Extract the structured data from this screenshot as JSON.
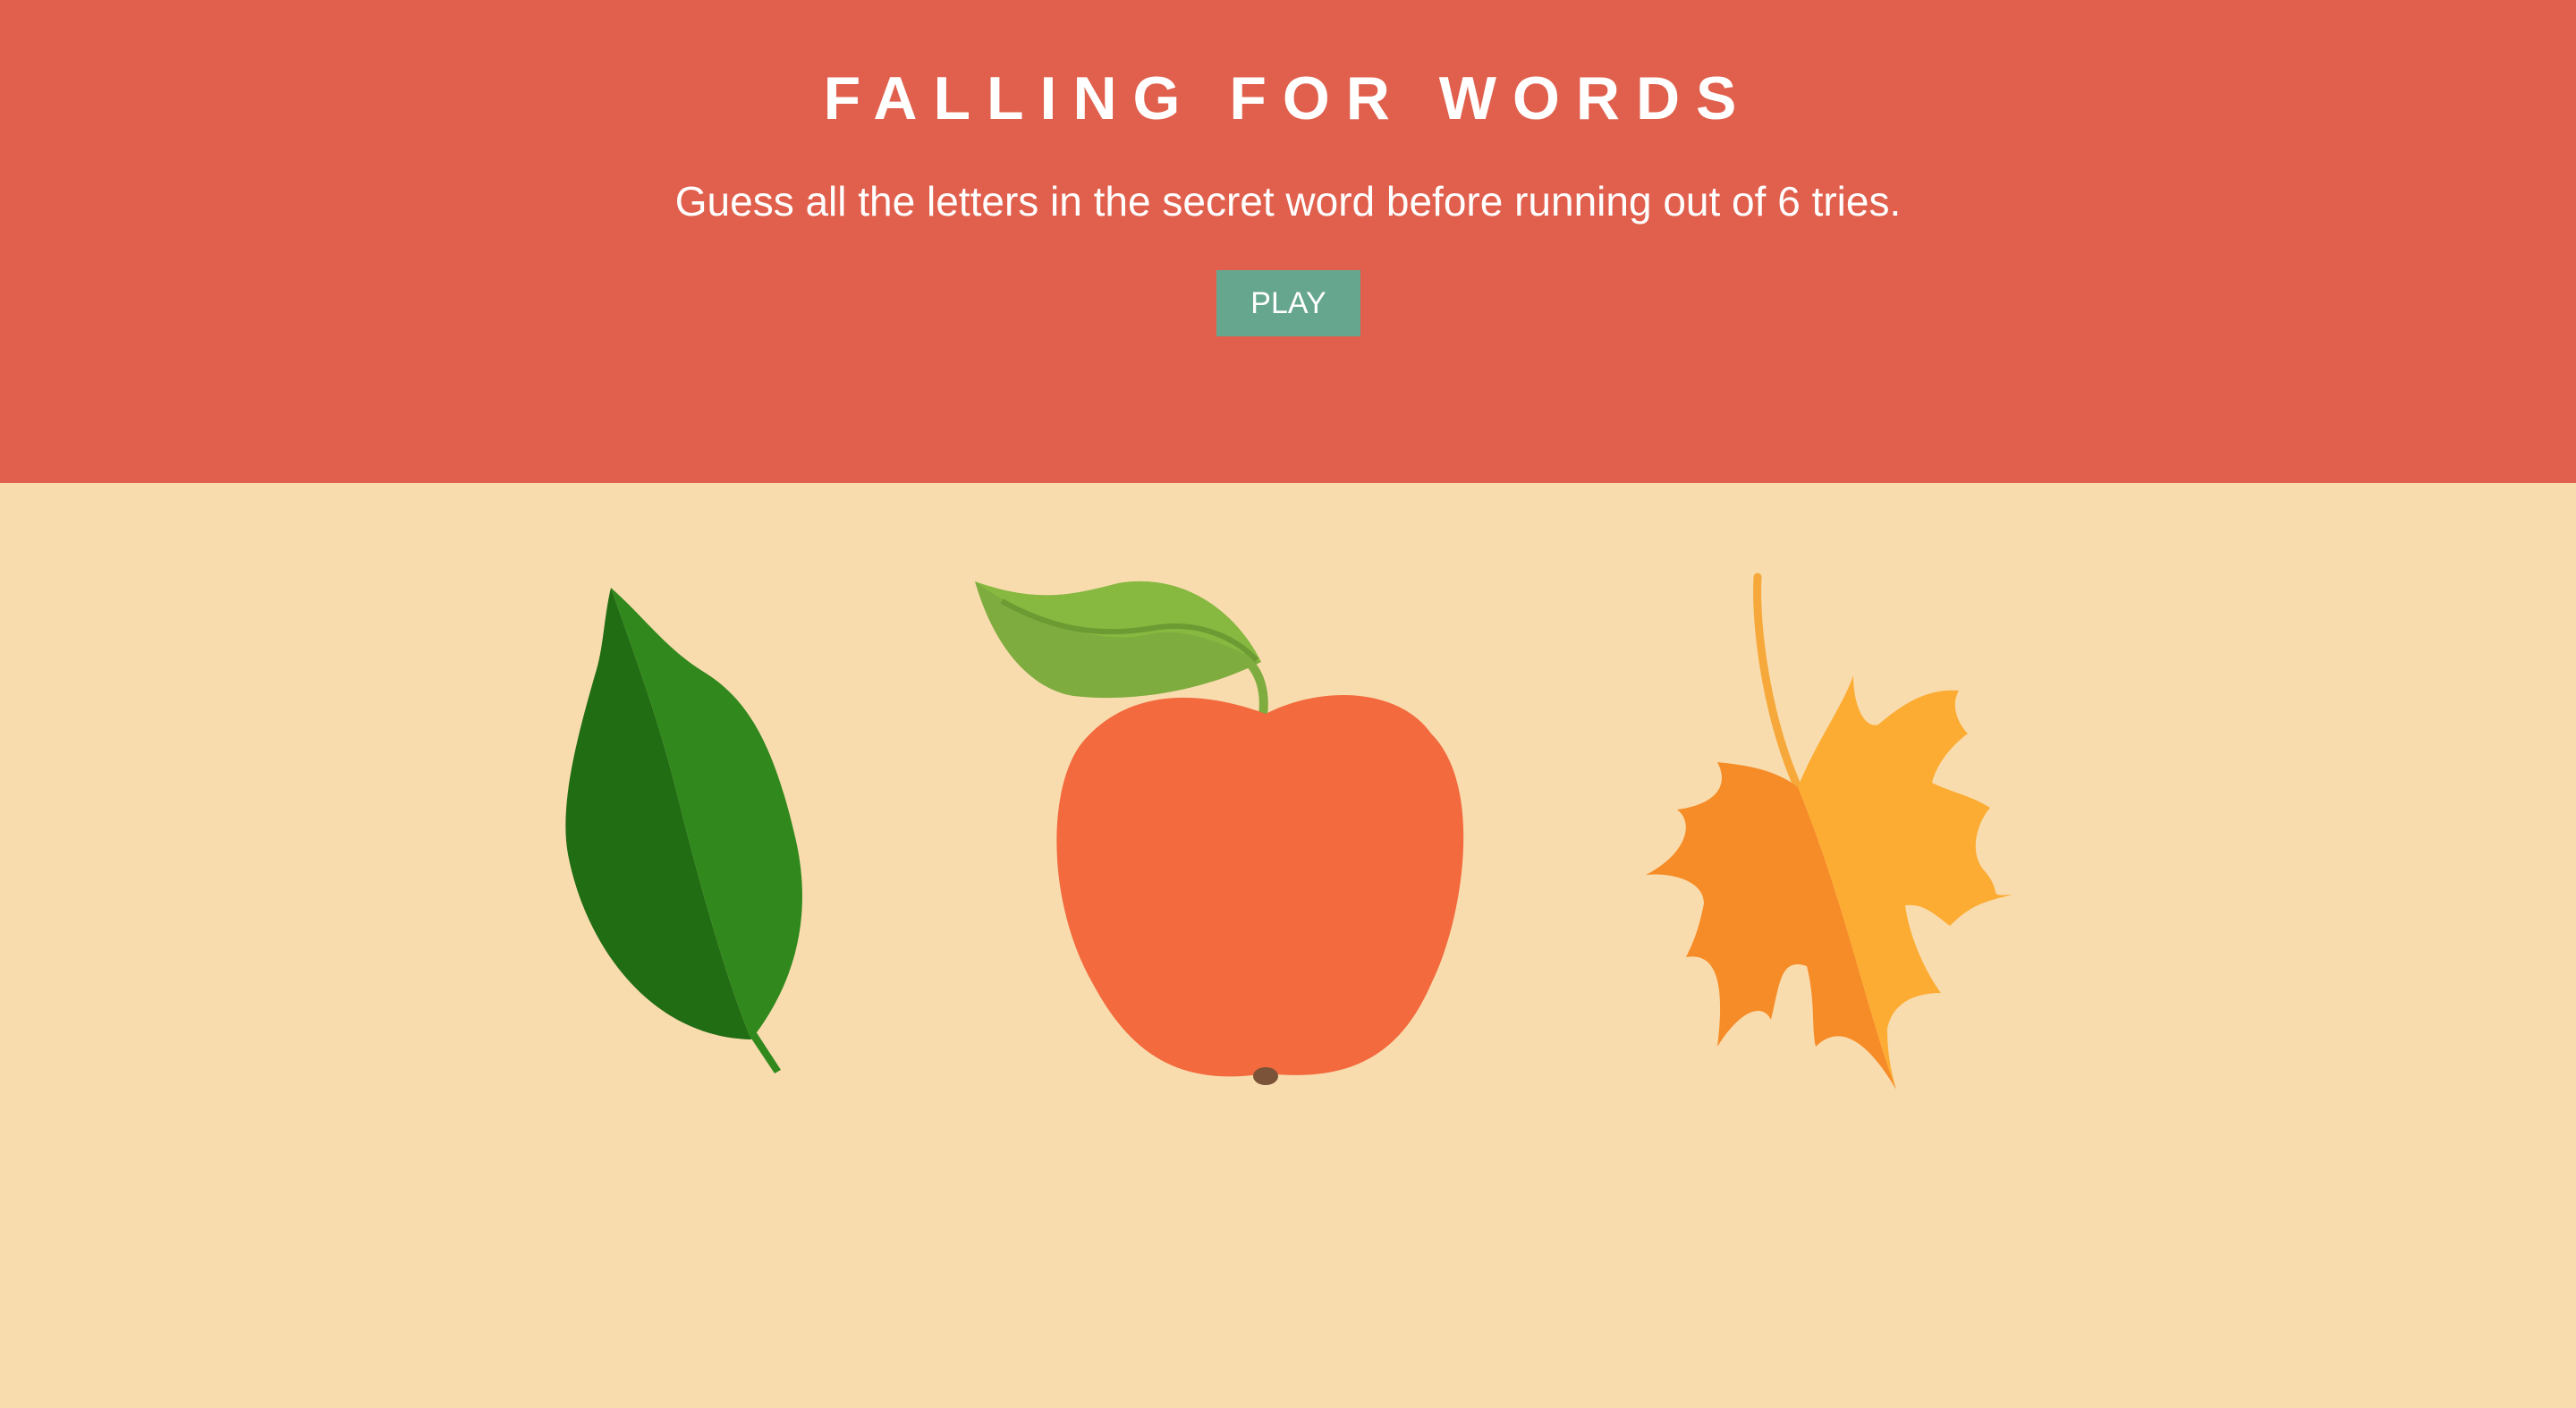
{
  "header": {
    "title": "FALLING FOR WORDS",
    "subtitle": "Guess all the letters in the secret word before running out of 6 tries.",
    "play_label": "PLAY"
  },
  "colors": {
    "header_bg": "#e0604d",
    "page_bg": "#f9dcae",
    "button_bg": "#66a68f",
    "text": "#ffffff"
  },
  "icons": [
    "green-leaf-icon",
    "apple-icon",
    "maple-leaf-icon"
  ]
}
